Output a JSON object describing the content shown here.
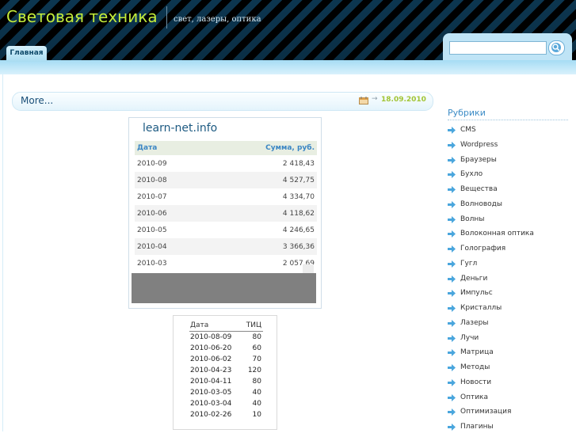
{
  "header": {
    "site_title": "Световая техника",
    "site_description": "свет, лазеры, оптика",
    "nav_tab": "Главная"
  },
  "search": {
    "placeholder": "",
    "icon": "search-icon"
  },
  "post": {
    "title": "More...",
    "date": "18.09.2010",
    "icons": [
      "calendar-icon",
      "arrow-icon"
    ]
  },
  "widget_learnnet": {
    "title": "learn-net.info",
    "columns": [
      "Дата",
      "Сумма, руб."
    ],
    "rows": [
      {
        "date": "2010-09",
        "sum": "2 418,43"
      },
      {
        "date": "2010-08",
        "sum": "4 527,75"
      },
      {
        "date": "2010-07",
        "sum": "4 334,70"
      },
      {
        "date": "2010-06",
        "sum": "4 118,62"
      },
      {
        "date": "2010-05",
        "sum": "4 246,65"
      },
      {
        "date": "2010-04",
        "sum": "3 366,36"
      },
      {
        "date": "2010-03",
        "sum": "2 057,69"
      }
    ]
  },
  "widget_tic": {
    "columns": [
      "Дата",
      "ТИЦ"
    ],
    "rows": [
      {
        "date": "2010-08-09",
        "tic": "80"
      },
      {
        "date": "2010-06-20",
        "tic": "60"
      },
      {
        "date": "2010-06-02",
        "tic": "70"
      },
      {
        "date": "2010-04-23",
        "tic": "120"
      },
      {
        "date": "2010-04-11",
        "tic": "80"
      },
      {
        "date": "2010-03-05",
        "tic": "40"
      },
      {
        "date": "2010-03-04",
        "tic": "40"
      },
      {
        "date": "2010-02-26",
        "tic": "10"
      }
    ]
  },
  "sidebar": {
    "title": "Рубрики",
    "categories": [
      "CMS",
      "Wordpress",
      "Браузеры",
      "Бухло",
      "Вещества",
      "Волноводы",
      "Волны",
      "Волоконная оптика",
      "Голография",
      "Гугл",
      "Деньги",
      "Импульс",
      "Кристаллы",
      "Лазеры",
      "Лучи",
      "Матрица",
      "Методы",
      "Новости",
      "Оптика",
      "Оптимизация",
      "Плагины"
    ]
  },
  "colors": {
    "title_green": "#c4ec3a",
    "link_blue": "#3c8cc6",
    "date_green": "#a2c535"
  }
}
